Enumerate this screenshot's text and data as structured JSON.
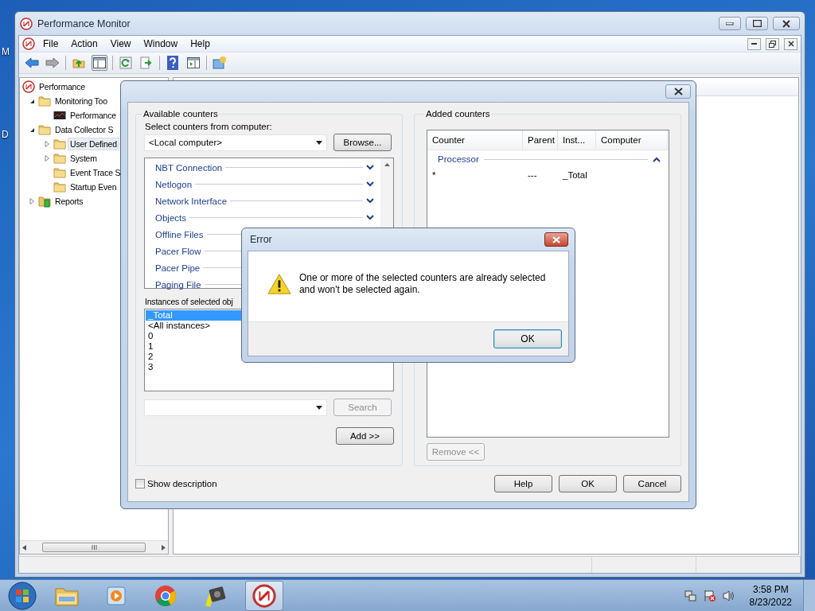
{
  "desktop": {
    "icon_labels": [
      "M",
      "D"
    ]
  },
  "main_window": {
    "title": "Performance Monitor",
    "menu": [
      "File",
      "Action",
      "View",
      "Window",
      "Help"
    ],
    "tree": [
      {
        "label": "Performance",
        "kind": "root",
        "selected": false,
        "children": [
          {
            "label": "Monitoring Too",
            "kind": "folder",
            "selected": false,
            "expanded": true,
            "children": [
              {
                "label": "Performance",
                "kind": "graph",
                "selected": false
              }
            ]
          },
          {
            "label": "Data Collector S",
            "kind": "folder",
            "selected": false,
            "expanded": true,
            "children": [
              {
                "label": "User Defined",
                "kind": "folder",
                "selected": true,
                "expanded": false
              },
              {
                "label": "System",
                "kind": "folder",
                "selected": false,
                "expanded": false
              },
              {
                "label": "Event Trace S",
                "kind": "folder",
                "selected": false
              },
              {
                "label": "Startup Even",
                "kind": "folder",
                "selected": false
              }
            ]
          },
          {
            "label": "Reports",
            "kind": "report",
            "selected": false,
            "expanded": false
          }
        ]
      }
    ]
  },
  "add_counters": {
    "available": {
      "title": "Available counters",
      "computer_label": "Select counters from computer:",
      "computer": "<Local computer>",
      "browse": {
        "label": "Browse...",
        "disabled": false
      },
      "counters": [
        {
          "name": "NBT Connection",
          "expanded": false
        },
        {
          "name": "Netlogon",
          "expanded": false
        },
        {
          "name": "Network Interface",
          "expanded": false
        },
        {
          "name": "Objects",
          "expanded": false
        },
        {
          "name": "Offline Files"
        },
        {
          "name": "Pacer Flow"
        },
        {
          "name": "Pacer Pipe"
        },
        {
          "name": "Paging File"
        }
      ],
      "instances_label": "Instances of selected obj",
      "instances": [
        {
          "label": "_Total",
          "selected": true
        },
        {
          "label": "<All instances>",
          "selected": false
        },
        {
          "label": "0",
          "selected": false
        },
        {
          "label": "1",
          "selected": false
        },
        {
          "label": "2",
          "selected": false
        },
        {
          "label": "3",
          "selected": false
        }
      ],
      "search": {
        "label": "Search",
        "disabled": true
      },
      "add": {
        "label": "Add >>",
        "disabled": false
      }
    },
    "added": {
      "title": "Added counters",
      "columns": [
        "Counter",
        "Parent",
        "Inst...",
        "Computer"
      ],
      "groups": [
        {
          "name": "Processor",
          "expanded": true,
          "rows": [
            {
              "counter": "*",
              "parent": "---",
              "instance": "_Total"
            }
          ]
        }
      ],
      "remove": {
        "label": "Remove <<",
        "disabled": true
      }
    },
    "show_description": {
      "label": "Show description",
      "checked": false
    },
    "buttons": [
      {
        "label": "Help",
        "disabled": false
      },
      {
        "label": "OK",
        "disabled": false
      },
      {
        "label": "Cancel",
        "disabled": false
      }
    ]
  },
  "error_dialog": {
    "title": "Error",
    "message": "One or more of the selected counters are already selected and won't be selected again.",
    "button": "OK"
  },
  "taskbar": {
    "pinned": [
      {
        "kind": "folder",
        "active": false
      },
      {
        "kind": "media",
        "active": false
      },
      {
        "kind": "browser",
        "active": false
      },
      {
        "kind": "camera",
        "active": false
      },
      {
        "kind": "gauge",
        "active": true
      }
    ],
    "clock": {
      "time": "3:58 PM",
      "date": "8/23/2022"
    }
  }
}
